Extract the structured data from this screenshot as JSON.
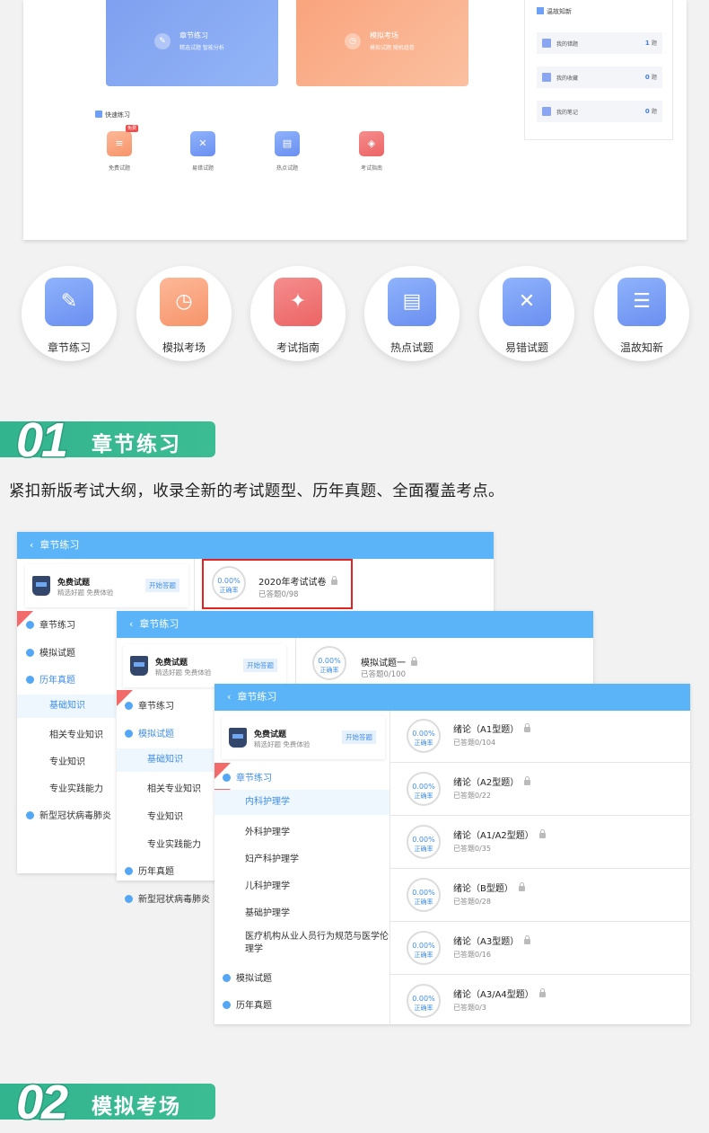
{
  "top_panel": {
    "cards": [
      {
        "title": "章节练习",
        "sub": "精选试题 智能分析"
      },
      {
        "title": "模拟考场",
        "sub": "模拟试题 随机组卷"
      }
    ],
    "quick_title": "快速练习",
    "quick_items": [
      {
        "label": "免费试题",
        "badge": "免费"
      },
      {
        "label": "易错试题"
      },
      {
        "label": "热点试题"
      },
      {
        "label": "考试指南"
      }
    ],
    "review": {
      "title": "温故知新",
      "rows": [
        {
          "label": "我的错题",
          "count": "1",
          "unit": "题"
        },
        {
          "label": "我的收藏",
          "count": "0",
          "unit": "题"
        },
        {
          "label": "我的笔记",
          "count": "0",
          "unit": "题"
        }
      ]
    }
  },
  "features": [
    {
      "label": "章节练习",
      "icon": "pencil-icon",
      "color": "#7b9cf3"
    },
    {
      "label": "模拟考场",
      "icon": "clock-icon",
      "color": "#f8a27c"
    },
    {
      "label": "考试指南",
      "icon": "compass-icon",
      "color": "#ee7070"
    },
    {
      "label": "热点试题",
      "icon": "documents-icon",
      "color": "#7b9cf3"
    },
    {
      "label": "易错试题",
      "icon": "wrong-book-icon",
      "color": "#7b9cf3"
    },
    {
      "label": "温故知新",
      "icon": "notebook-icon",
      "color": "#7b9cf3"
    }
  ],
  "section1": {
    "num": "01",
    "title": "章节练习"
  },
  "description": "紧扣新版考试大纲，收录全新的考试题型、历年真题、全面覆盖考点。",
  "section2": {
    "num": "02",
    "title": "模拟考场"
  },
  "common": {
    "header": "章节练习",
    "book_title": "免费试题",
    "book_sub": "精选好题 免费体验",
    "start_btn": "开始答题",
    "ring_pct": "0.00%",
    "ring_label": "正确率"
  },
  "panel1": {
    "menu": [
      "章节练习",
      "模拟试题",
      "历年真题"
    ],
    "subs": [
      "基础知识",
      "相关专业知识",
      "专业知识",
      "专业实践能力"
    ],
    "last": "新型冠状病毒肺炎",
    "exam_title": "2020年考试试卷",
    "exam_sub": "已答题0/98"
  },
  "panel2": {
    "menu": [
      "章节练习",
      "模拟试题"
    ],
    "subs": [
      "基础知识",
      "相关专业知识",
      "专业知识",
      "专业实践能力"
    ],
    "after": [
      "历年真题",
      "新型冠状病毒肺炎"
    ],
    "exam_title": "模拟试题一",
    "exam_sub": "已答题0/100"
  },
  "panel3": {
    "menu_top": "章节练习",
    "subs": [
      "内科护理学",
      "外科护理学",
      "妇产科护理学",
      "儿科护理学",
      "基础护理学",
      "医疗机构从业人员行为规范与医学伦理学"
    ],
    "after": [
      "模拟试题",
      "历年真题"
    ],
    "rows": [
      {
        "title": "绪论（A1型题）",
        "sub": "已答题0/104"
      },
      {
        "title": "绪论（A2型题）",
        "sub": "已答题0/22"
      },
      {
        "title": "绪论（A1/A2型题）",
        "sub": "已答题0/35"
      },
      {
        "title": "绪论（B型题）",
        "sub": "已答题0/28"
      },
      {
        "title": "绪论（A3型题）",
        "sub": "已答题0/16"
      },
      {
        "title": "绪论（A3/A4型题）",
        "sub": "已答题0/3"
      }
    ]
  }
}
